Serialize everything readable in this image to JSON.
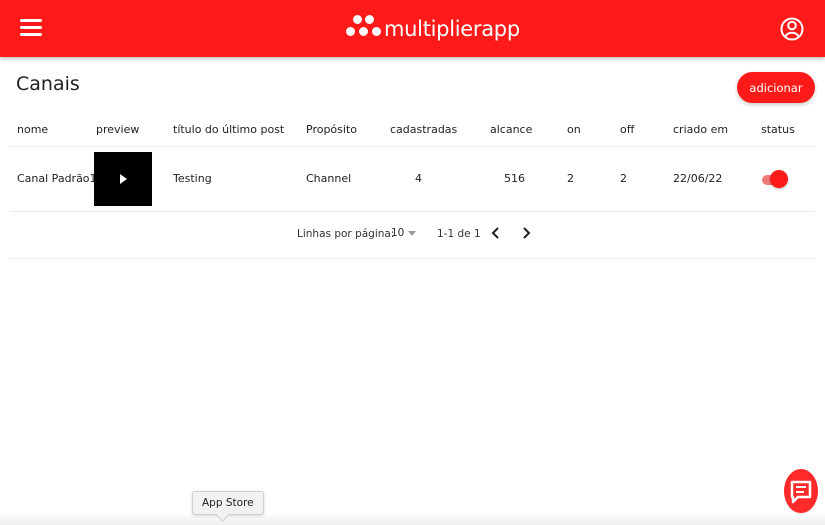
{
  "header": {
    "brand_name": "multiplierapp",
    "menu_icon": "hamburger-menu-icon",
    "profile_icon": "user-circle-icon",
    "background_color": "#ff1a1a"
  },
  "page": {
    "title": "Canais",
    "add_button_label": "adicionar"
  },
  "table": {
    "columns": [
      "nome",
      "preview",
      "título do último post",
      "Propósito",
      "cadastradas",
      "alcance",
      "on",
      "off",
      "criado em",
      "status"
    ],
    "rows": [
      {
        "nome": "Canal Padrão1",
        "preview_icon": "play-icon",
        "titulo": "Testing",
        "proposito": "Channel",
        "cadastradas": "4",
        "alcance": "516",
        "on": "2",
        "off": "2",
        "criado_em": "22/06/22",
        "status_on": true
      }
    ]
  },
  "pagination": {
    "rows_per_page_label": "Linhas por página:",
    "rows_per_page_value": "10",
    "range_text": "1-1 de 1",
    "prev_icon": "chevron-left-icon",
    "next_icon": "chevron-right-icon"
  },
  "tooltip": {
    "text": "App Store"
  },
  "chat_icon": "chat-bubble-icon"
}
